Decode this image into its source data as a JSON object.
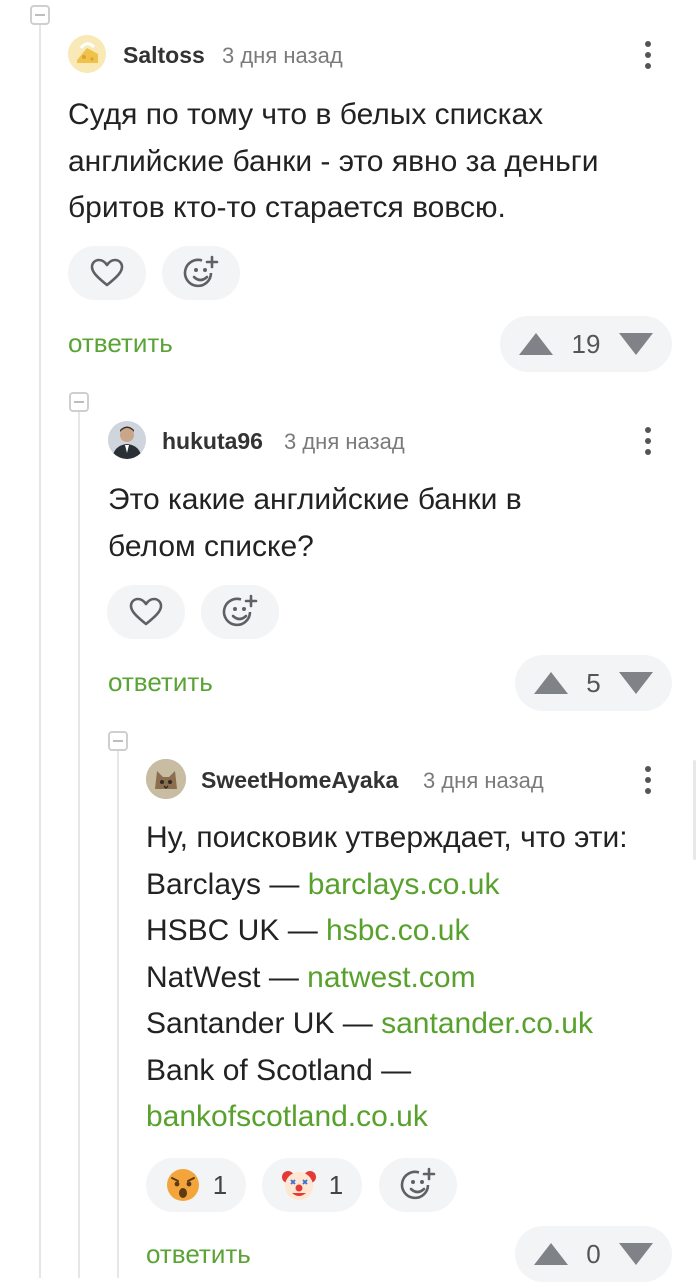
{
  "comments": [
    {
      "username": "Saltoss",
      "time": "3 дня назад",
      "lines": [
        "Судя по тому что в белых списках",
        "английские банки - это явно за деньги",
        "бритов кто-то старается вовсю."
      ],
      "reply": "ответить",
      "votes": "19"
    },
    {
      "username": "hukuta96",
      "time": "3 дня назад",
      "lines": [
        "Это какие английские банки в",
        "белом списке?"
      ],
      "reply": "ответить",
      "votes": "5"
    },
    {
      "username": "SweetHomeAyaka",
      "time": "3 дня назад",
      "intro": "Ну, поисковик утверждает, что эти:",
      "banks": [
        {
          "name": "Barclays — ",
          "link": "barclays.co.uk"
        },
        {
          "name": "HSBC UK — ",
          "link": "hsbc.co.uk"
        },
        {
          "name": "NatWest — ",
          "link": "natwest.com"
        },
        {
          "name": "Santander UK — ",
          "link": "santander.co.uk"
        },
        {
          "name": "Bank of Scotland — ",
          "link": ""
        }
      ],
      "last_link": "bankofscotland.co.uk",
      "reactions": [
        {
          "icon": "scared-face-icon",
          "count": "1"
        },
        {
          "icon": "clown-face-icon",
          "count": "1"
        }
      ],
      "reply": "ответить",
      "votes": "0"
    }
  ],
  "colors": {
    "accent": "#57a12c",
    "pill_bg": "#f3f4f5",
    "vote_arrow": "#7f8287"
  }
}
